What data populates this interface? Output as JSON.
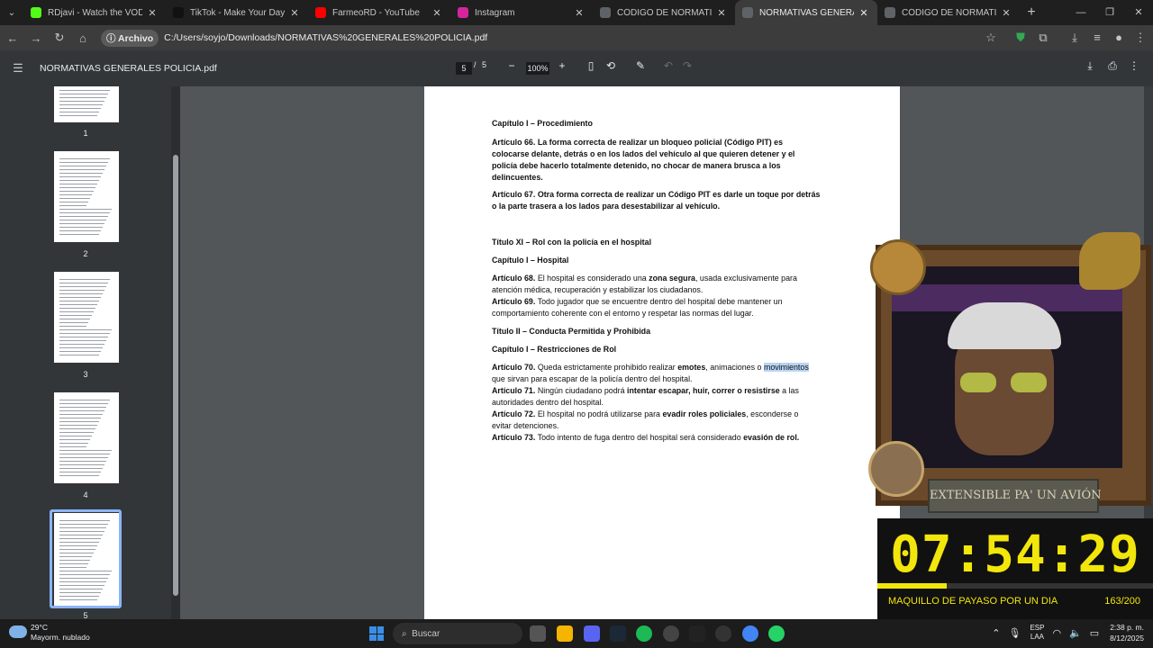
{
  "browser": {
    "tabs": [
      {
        "title": "RDjavi - Watch the VOD on Kick",
        "favicon_color": "#53fc18"
      },
      {
        "title": "TikTok - Make Your Day",
        "favicon_color": "#111111"
      },
      {
        "title": "FarmeoRD - YouTube",
        "favicon_color": "#ff0000"
      },
      {
        "title": "Instagram",
        "favicon_color": "#d6249f"
      },
      {
        "title": "CÓDIGO DE NORMATIVAS GEN",
        "favicon_color": "#5f6368"
      },
      {
        "title": "NORMATIVAS GENERALES POL",
        "favicon_color": "#5f6368"
      },
      {
        "title": "CÓDIGO DE NORMATIVAS DEL",
        "favicon_color": "#5f6368"
      }
    ],
    "active_tab_index": 5,
    "address_chip": "Archivo",
    "address": "C:/Users/soyjo/Downloads/NORMATIVAS%20GENERALES%20POLICIA.pdf"
  },
  "pdf": {
    "title": "NORMATIVAS GENERALES POLICIA.pdf",
    "current_page": "5",
    "separator": "/",
    "total_pages": "5",
    "zoom": "100%"
  },
  "thumbnails": [
    "1",
    "2",
    "3",
    "4",
    "5"
  ],
  "document": {
    "cap_procedimiento": "Capítulo I – Procedimiento",
    "a66_label": "Artículo 66.",
    "a66_l1": "La forma correcta de realizar un bloqueo policial (Código PIT) es",
    "a66_l2": "colocarse delante, detrás o en los lados del  vehículo al que quieren detener y el",
    "a66_l3": "policía debe hacerlo totalmente detenido, no chocar de manera brusca a los",
    "a66_l4": "delincuentes.",
    "a67_label": "Artículo 67.",
    "a67_l1": "Otra forma correcta de realizar un Código PIT es darle un toque por detrás",
    "a67_l2": "o la parte trasera a los lados para desestabilizar al vehículo.",
    "titulo_xi": "Título XI – Rol con la policía en el hospital",
    "cap_hospital": "Capítulo I – Hospital",
    "a68_label": "Artículo 68.",
    "a68_t1": "El hospital es considerado una",
    "a68_b1": "zona segura",
    "a68_t2": ", usada exclusivamente para",
    "a68_l2": "atención médica, recuperación y estabilizar los ciudadanos.",
    "a69_label": "Artículo 69.",
    "a69_l1": "Todo jugador que se encuentre dentro del hospital debe mantener un",
    "a69_l2": "comportamiento coherente con el entorno y respetar las normas del lugar.",
    "titulo_ii": "Título II – Conducta Permitida y Prohibida",
    "cap_restricciones": "Capítulo I – Restricciones de Rol",
    "a70_label": "Artículo 70.",
    "a70_t1": "Queda estrictamente prohibido realizar",
    "a70_b1": "emotes",
    "a70_t2": ", animaciones o",
    "a70_hl": "movimientos",
    "a70_l2": "que sirvan para escapar de la policía dentro del hospital.",
    "a71_label": "Artículo 71.",
    "a71_t1": "Ningún ciudadano podrá",
    "a71_b1": "intentar escapar, huir, correr o resistirse",
    "a71_t2": "a las",
    "a71_l2": "autoridades dentro del hospital.",
    "a72_label": "Artículo 72.",
    "a72_t1": "El hospital no podrá utilizarse para",
    "a72_b1": "evadir roles policiales",
    "a72_t2": ", esconderse o",
    "a72_l2": "evitar detenciones.",
    "a73_label": "Artículo 73.",
    "a73_t1": "Todo intento de fuga dentro del hospital será considerado",
    "a73_b1": "evasión de rol."
  },
  "stream_overlay": {
    "banner": "EXTENSIBLE PA' UN AVIÓN",
    "timer": "07:54:29",
    "goal_label": "MAQUILLO DE PAYASO POR UN DIA",
    "goal_count": "163/200",
    "goal_progress": 0.25,
    "accent_color": "#f2e60a"
  },
  "taskbar": {
    "weather_temp": "29°C",
    "weather_desc": "Mayorm. nublado",
    "search_placeholder": "Buscar",
    "lang_1": "ESP",
    "lang_2": "LAA",
    "time": "2:38 p. m.",
    "date": "8/12/2025"
  }
}
